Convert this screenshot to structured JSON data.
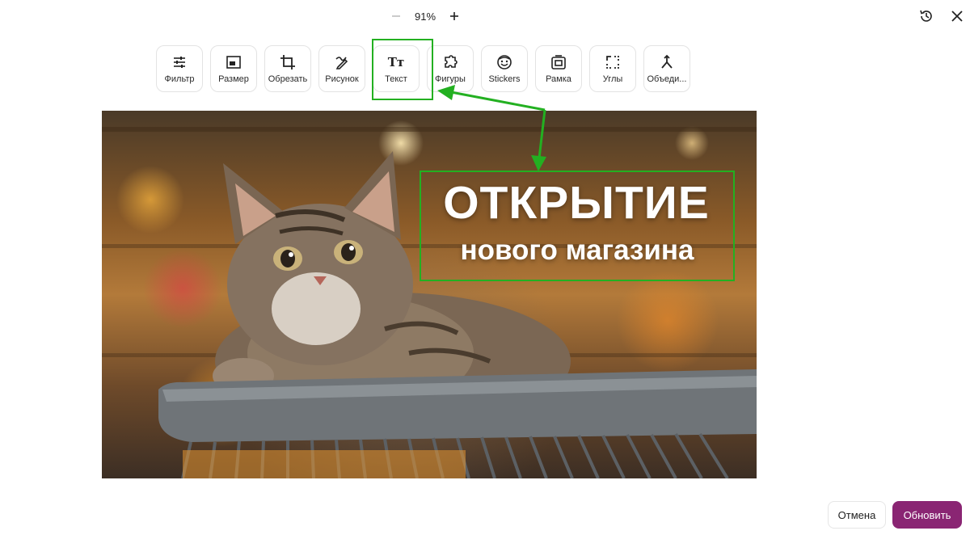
{
  "zoom": {
    "value": "91%",
    "decrease_icon": "minus-icon",
    "increase_icon": "plus-icon"
  },
  "top_right": {
    "history_icon": "history-icon",
    "close_icon": "close-icon"
  },
  "toolbar": [
    {
      "label": "Фильтр",
      "icon": "sliders-icon"
    },
    {
      "label": "Размер",
      "icon": "resize-icon"
    },
    {
      "label": "Обрезать",
      "icon": "crop-icon"
    },
    {
      "label": "Рисунок",
      "icon": "draw-icon"
    },
    {
      "label": "Текст",
      "icon": "text-icon",
      "glyph": "Tт"
    },
    {
      "label": "Фигуры",
      "icon": "shapes-icon"
    },
    {
      "label": "Stickers",
      "icon": "sticker-icon"
    },
    {
      "label": "Рамка",
      "icon": "frame-icon"
    },
    {
      "label": "Углы",
      "icon": "corners-icon"
    },
    {
      "label": "Объеди...",
      "icon": "merge-icon"
    }
  ],
  "image": {
    "headline": "ОТКРЫТИЕ",
    "subline": "нового магазина"
  },
  "annotation": {
    "color": "#23b021"
  },
  "footer": {
    "cancel_label": "Отмена",
    "update_label": "Обновить",
    "accent": "#8a2573"
  }
}
